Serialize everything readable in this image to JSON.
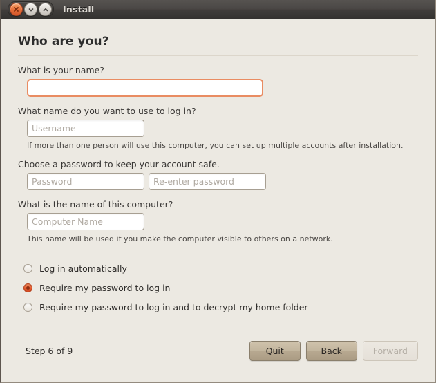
{
  "window": {
    "title": "Install",
    "buttons": [
      {
        "name": "close",
        "icon": "close-icon"
      },
      {
        "name": "minimize",
        "icon": "chevron-down-icon"
      },
      {
        "name": "maximize",
        "icon": "chevron-up-icon"
      }
    ]
  },
  "page": {
    "heading": "Who are you?"
  },
  "fields": {
    "name": {
      "label": "What is your name?",
      "value": "",
      "placeholder": ""
    },
    "username": {
      "label": "What name do you want to use to log in?",
      "value": "",
      "placeholder": "Username",
      "hint": "If more than one person will use this computer, you can set up multiple accounts after installation."
    },
    "password": {
      "label": "Choose a password to keep your account safe.",
      "value": "",
      "placeholder": "Password"
    },
    "password_confirm": {
      "value": "",
      "placeholder": "Re-enter password"
    },
    "computer": {
      "label": "What is the name of this computer?",
      "value": "",
      "placeholder": "Computer Name",
      "hint": "This name will be used if you make the computer visible to others on a network."
    }
  },
  "login_options": [
    {
      "label": "Log in automatically",
      "selected": false
    },
    {
      "label": "Require my password to log in",
      "selected": true
    },
    {
      "label": "Require my password to log in and to decrypt my home folder",
      "selected": false
    }
  ],
  "footer": {
    "step_text": "Step 6 of 9",
    "quit_label": "Quit",
    "back_label": "Back",
    "forward_label": "Forward"
  },
  "colors": {
    "background": "#ece9e2",
    "accent": "#e4582c",
    "focus_border": "#e98c62",
    "titlebar": "#443f3c",
    "button": "#bdb098"
  }
}
